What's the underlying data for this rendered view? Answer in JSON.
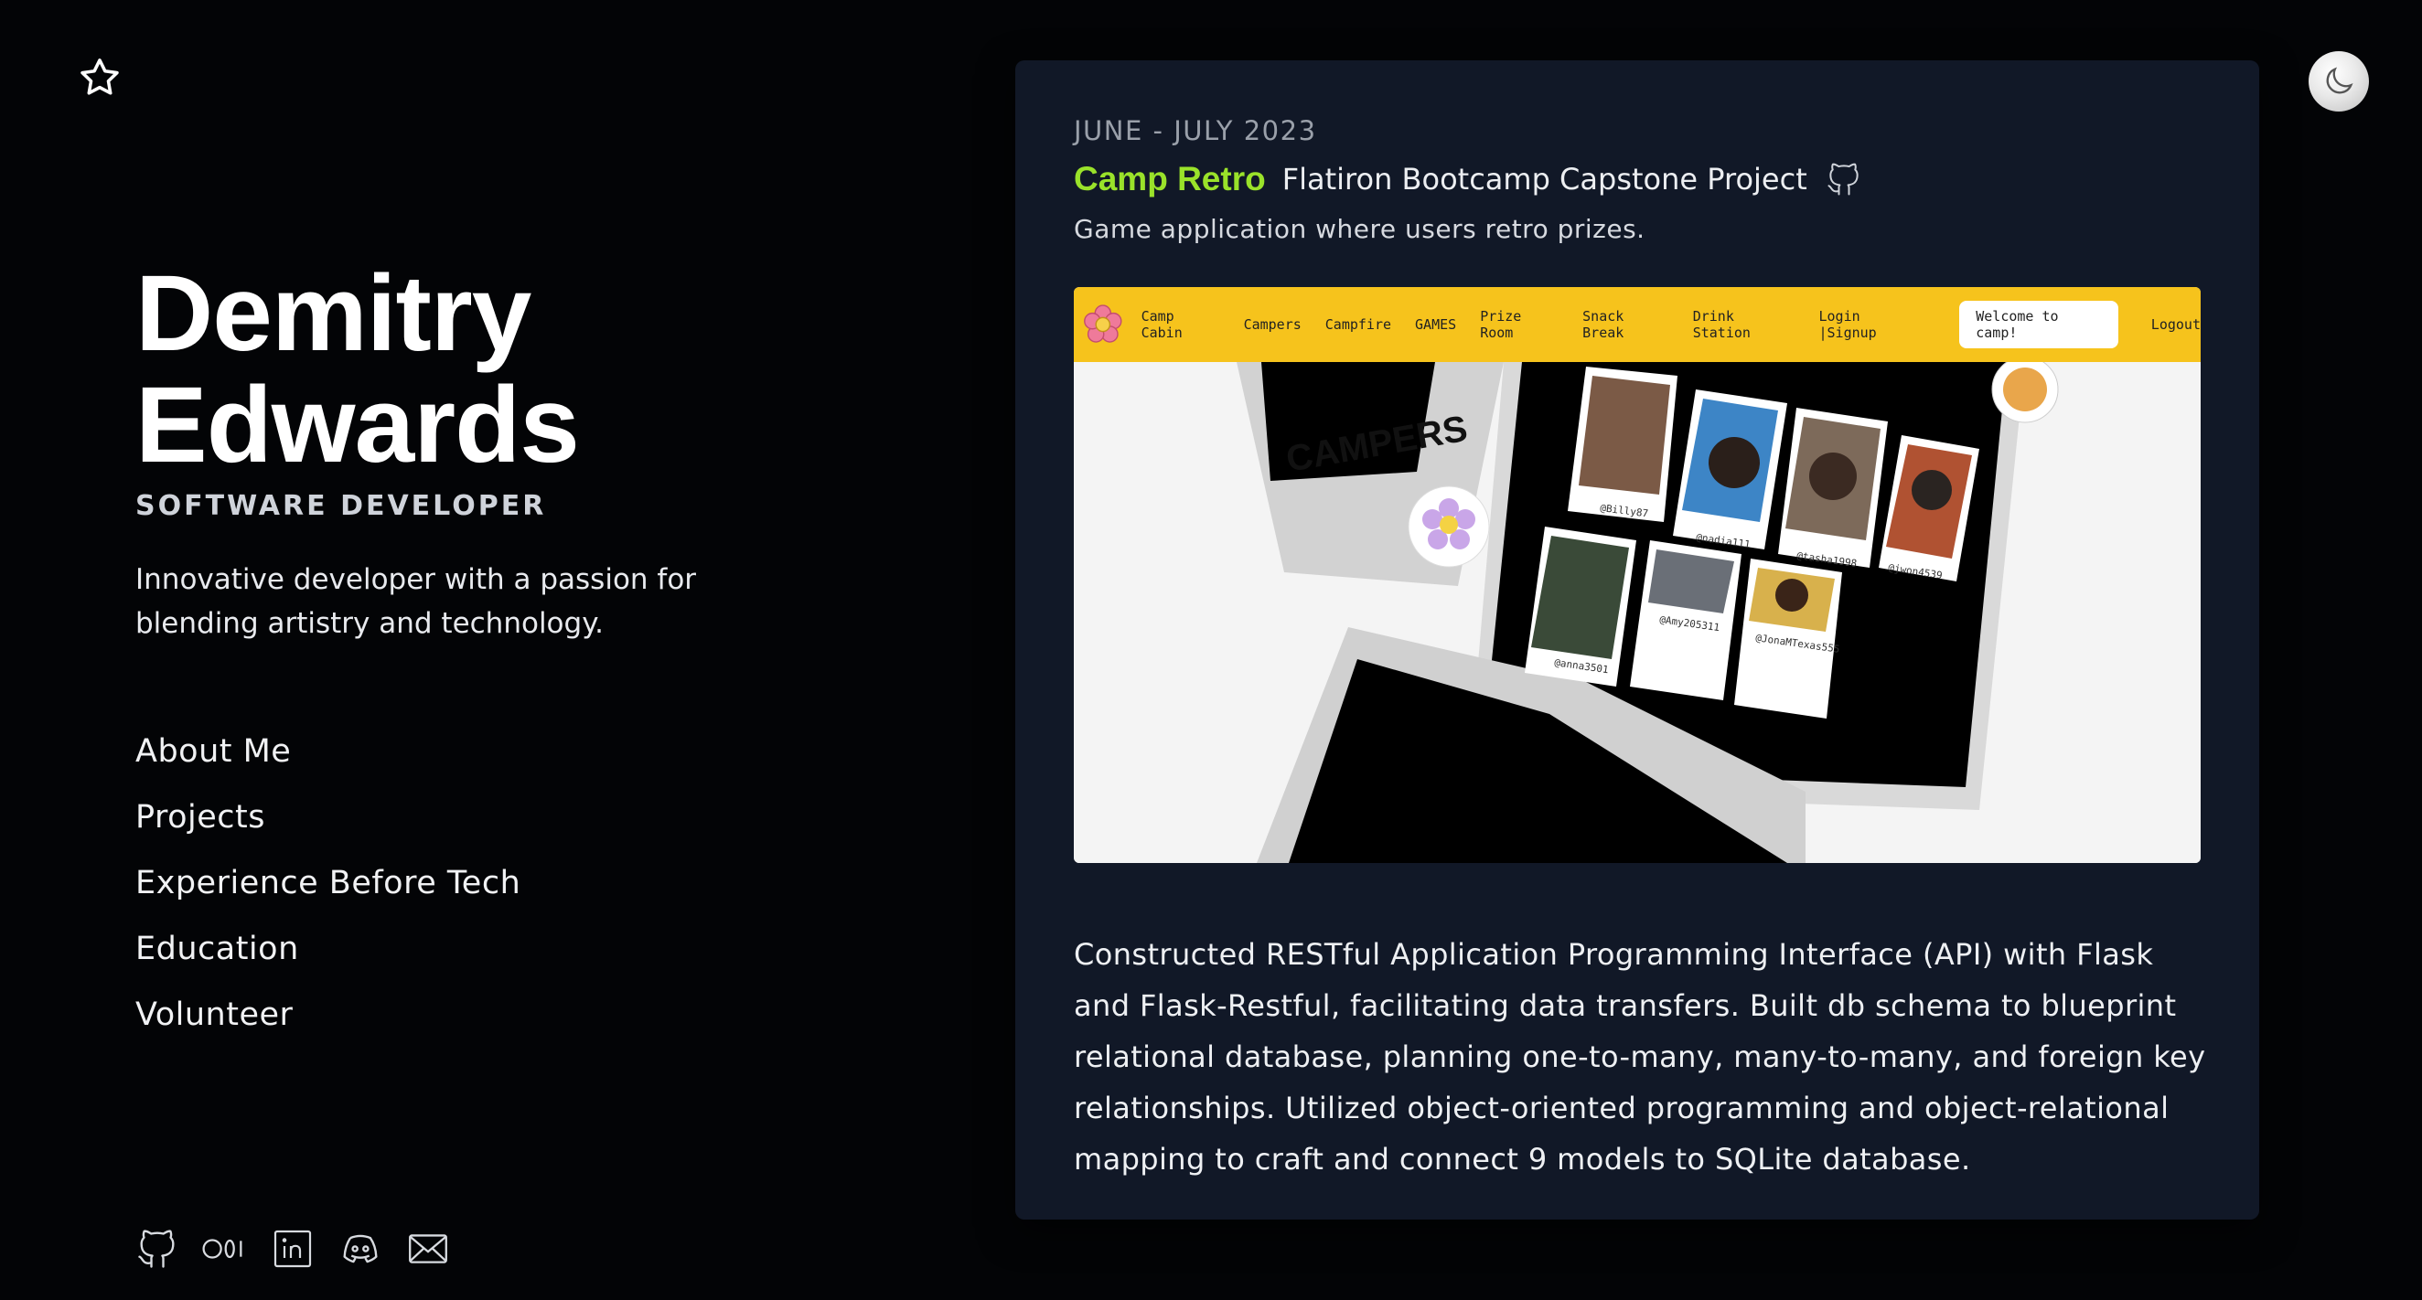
{
  "profile": {
    "name_line1": "Demitry",
    "name_line2": "Edwards",
    "role": "SOFTWARE DEVELOPER",
    "bio": "Innovative developer with a passion for blending artistry and technology."
  },
  "nav": {
    "items": [
      "About Me",
      "Projects",
      "Experience Before Tech",
      "Education",
      "Volunteer"
    ]
  },
  "icons": {
    "favorite": "star-icon",
    "theme": "moon-icon",
    "socials": [
      "github-icon",
      "medium-icon",
      "linkedin-icon",
      "discord-icon",
      "mail-icon"
    ]
  },
  "project": {
    "date": "JUNE - JULY 2023",
    "title": "Camp Retro",
    "subtitle": "Flatiron Bootcamp Capstone Project",
    "tagline": "Game application where users retro prizes.",
    "description": "Constructed RESTful Application Programming Interface (API) with Flask and Flask-Restful, facilitating data transfers. Built db schema to blueprint relational database, planning one-to-many, many-to-many, and foreign key relationships. Utilized object-oriented programming and object-relational mapping to craft and connect 9 models to SQLite database.",
    "screenshot": {
      "nav_items": [
        "Camp Cabin",
        "Campers",
        "Campfire",
        "GAMES",
        "Prize Room",
        "Snack Break",
        "Drink Station",
        "Login |Signup"
      ],
      "welcome": "Welcome to camp!",
      "logout": "Logout",
      "heading": "CAMPERS",
      "handles": [
        "@Billy87",
        "@nadia111",
        "@tasha1998",
        "@jwon4539",
        "@anna3501",
        "@Amy205311",
        "@JonaMTexas555"
      ]
    }
  },
  "colors": {
    "background": "#030406",
    "card": "#111827",
    "accent": "#9ae22a",
    "screenshot_bar": "#f6c31c"
  }
}
